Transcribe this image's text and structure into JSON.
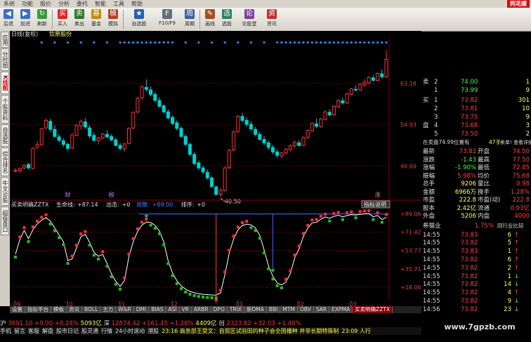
{
  "menubar": {
    "items": [
      "系统",
      "功能",
      "报价",
      "分析",
      "委托",
      "智能",
      "工具",
      "帮助"
    ],
    "brand": "同花顺"
  },
  "toolbar": {
    "buttons": [
      {
        "label": "后退",
        "color": "#3a6fc4",
        "icon": "◀"
      },
      {
        "label": "前进",
        "color": "#3a6fc4",
        "icon": "▶"
      },
      {
        "label": "刷新",
        "color": "#3a9a3a",
        "icon": "↻"
      },
      {
        "label": "买入",
        "color": "#d22",
        "icon": "买"
      },
      {
        "label": "卖出",
        "color": "#2a7a2a",
        "icon": "卖"
      },
      {
        "label": "基金",
        "color": "#c58a00",
        "icon": "基"
      },
      {
        "label": "模拟",
        "color": "#b04020",
        "icon": "模"
      },
      {
        "label": "自选股",
        "color": "#2a5fb0",
        "icon": "★"
      },
      {
        "label": "F10/F9",
        "color": "#607080",
        "icon": "F"
      },
      {
        "label": "周期",
        "color": "#4060a0",
        "icon": "周"
      },
      {
        "label": "画线",
        "color": "#a05020",
        "icon": "✎"
      },
      {
        "label": "选股",
        "color": "#2a8060",
        "icon": "选"
      },
      {
        "label": "论股堂",
        "color": "#8040a0",
        "icon": "论"
      },
      {
        "label": "资讯",
        "color": "#c03030",
        "icon": "资"
      }
    ]
  },
  "left_tabs": [
    {
      "label": "应用",
      "active": false
    },
    {
      "label": "分时图",
      "active": false
    },
    {
      "label": "K线图",
      "active": true
    },
    {
      "label": "个股资料",
      "active": false
    },
    {
      "label": "自选股",
      "active": false
    },
    {
      "label": "综合排名",
      "active": false
    },
    {
      "label": "牛叉诊股",
      "active": false
    },
    {
      "label": "超级盘口",
      "active": false
    }
  ],
  "chart_header": {
    "period": "日线(复权)",
    "stock": "钦原股份"
  },
  "chart_data": {
    "type": "candlestick",
    "price_axis": {
      "ticks": [
        {
          "label": "63.18",
          "value": 63.18
        },
        {
          "label": "54.93",
          "value": 54.93
        },
        {
          "label": "46.69",
          "value": 46.69
        }
      ],
      "range": [
        40,
        72
      ]
    },
    "low_marker": "40.50",
    "candles": [
      [
        45.8,
        46.3,
        45.4,
        45.8
      ],
      [
        45.8,
        46.4,
        45.3,
        46.2
      ],
      [
        46.3,
        47.0,
        46.0,
        46.8
      ],
      [
        47.0,
        47.3,
        46.0,
        46.3
      ],
      [
        46.2,
        50.4,
        46.0,
        50.2
      ],
      [
        50.5,
        51.6,
        50.0,
        51.0
      ],
      [
        51.0,
        54.3,
        50.8,
        54.1
      ],
      [
        54.3,
        56.2,
        54.0,
        55.8
      ],
      [
        55.6,
        56.1,
        53.5,
        54.0
      ],
      [
        54.0,
        54.8,
        52.3,
        52.6
      ],
      [
        52.5,
        53.0,
        51.4,
        51.8
      ],
      [
        51.7,
        52.2,
        50.5,
        51.0
      ],
      [
        51.0,
        51.3,
        49.8,
        50.2
      ],
      [
        50.3,
        53.2,
        50.0,
        52.9
      ],
      [
        52.8,
        55.0,
        52.6,
        54.8
      ],
      [
        54.7,
        56.0,
        54.0,
        55.6
      ],
      [
        55.5,
        56.2,
        54.1,
        54.5
      ],
      [
        54.3,
        54.9,
        52.2,
        52.7
      ],
      [
        52.8,
        53.4,
        51.5,
        51.8
      ],
      [
        51.8,
        52.5,
        51.0,
        52.3
      ],
      [
        52.3,
        53.3,
        52.0,
        53.1
      ],
      [
        53.0,
        53.8,
        52.2,
        52.5
      ],
      [
        52.6,
        53.0,
        51.6,
        51.9
      ],
      [
        51.9,
        52.3,
        50.6,
        50.8
      ],
      [
        50.8,
        51.3,
        49.8,
        50.2
      ],
      [
        50.1,
        51.3,
        49.5,
        51.1
      ],
      [
        51.2,
        54.4,
        51.0,
        54.2
      ],
      [
        54.3,
        57.6,
        54.0,
        57.4
      ],
      [
        57.5,
        60.5,
        57.2,
        60.2
      ],
      [
        60.3,
        62.8,
        60.0,
        62.5
      ],
      [
        62.4,
        64.0,
        61.5,
        62.0
      ],
      [
        61.9,
        62.6,
        60.6,
        61.0
      ],
      [
        61.0,
        61.5,
        59.4,
        59.8
      ],
      [
        59.8,
        60.4,
        58.3,
        58.6
      ],
      [
        58.7,
        59.0,
        57.2,
        57.5
      ],
      [
        57.5,
        58.0,
        56.0,
        56.3
      ],
      [
        56.4,
        56.8,
        54.8,
        55.2
      ],
      [
        55.3,
        55.8,
        53.8,
        54.2
      ],
      [
        54.2,
        54.6,
        52.3,
        52.6
      ],
      [
        52.6,
        53.0,
        50.6,
        51.0
      ],
      [
        51.0,
        51.4,
        48.7,
        49.0
      ],
      [
        49.0,
        49.5,
        46.8,
        47.2
      ],
      [
        47.3,
        47.8,
        45.9,
        46.3
      ],
      [
        46.3,
        46.8,
        45.0,
        45.5
      ],
      [
        45.4,
        46.0,
        44.0,
        44.3
      ],
      [
        44.3,
        44.6,
        42.3,
        42.6
      ],
      [
        42.5,
        42.8,
        40.8,
        41.0
      ],
      [
        41.0,
        42.3,
        40.5,
        41.8
      ],
      [
        41.8,
        46.6,
        41.5,
        46.3
      ],
      [
        46.4,
        50.1,
        46.0,
        49.8
      ],
      [
        49.9,
        53.8,
        49.6,
        53.5
      ],
      [
        53.6,
        56.9,
        53.3,
        56.6
      ],
      [
        56.6,
        57.3,
        55.4,
        55.8
      ],
      [
        55.8,
        56.4,
        54.5,
        55.0
      ],
      [
        55.0,
        55.6,
        53.7,
        54.1
      ],
      [
        54.0,
        54.5,
        52.6,
        53.0
      ],
      [
        53.0,
        53.5,
        51.7,
        52.0
      ],
      [
        52.0,
        52.6,
        50.8,
        51.3
      ],
      [
        51.3,
        51.8,
        49.9,
        50.4
      ],
      [
        50.4,
        50.9,
        49.0,
        49.5
      ],
      [
        49.5,
        50.0,
        48.3,
        48.8
      ],
      [
        48.7,
        49.5,
        48.2,
        49.3
      ],
      [
        49.3,
        50.3,
        49.0,
        50.0
      ],
      [
        50.0,
        51.0,
        49.6,
        50.7
      ],
      [
        50.7,
        51.7,
        50.3,
        51.4
      ],
      [
        51.3,
        51.8,
        50.5,
        50.8
      ],
      [
        50.8,
        52.6,
        50.6,
        52.4
      ],
      [
        52.4,
        54.0,
        52.1,
        53.8
      ],
      [
        53.7,
        55.4,
        53.5,
        55.2
      ],
      [
        55.1,
        56.2,
        54.3,
        54.6
      ],
      [
        54.6,
        56.3,
        54.3,
        56.1
      ],
      [
        56.0,
        57.8,
        55.8,
        57.5
      ],
      [
        57.4,
        58.0,
        56.6,
        56.9
      ],
      [
        56.9,
        58.8,
        56.7,
        58.6
      ],
      [
        58.5,
        60.0,
        58.3,
        59.8
      ],
      [
        59.7,
        60.3,
        59.0,
        59.3
      ],
      [
        59.3,
        61.3,
        59.1,
        61.1
      ],
      [
        61.0,
        62.3,
        60.8,
        62.1
      ],
      [
        62.0,
        62.8,
        61.6,
        61.9
      ],
      [
        61.9,
        63.2,
        61.7,
        63.0
      ],
      [
        62.9,
        64.0,
        62.5,
        63.4
      ],
      [
        63.3,
        64.6,
        63.0,
        64.4
      ],
      [
        64.3,
        64.8,
        63.6,
        63.8
      ],
      [
        63.8,
        65.4,
        63.6,
        65.2
      ],
      [
        65.1,
        66.0,
        64.2,
        64.5
      ],
      [
        64.5,
        69.9,
        64.3,
        68.0
      ]
    ],
    "indicator": {
      "name": "买卖明确ZZTX",
      "params": [
        {
          "label": "生命线:",
          "value": "+87.14"
        },
        {
          "label": "出击:",
          "value": "+0"
        },
        {
          "label": "观察:",
          "value": "+89.00"
        },
        {
          "label": "排序:",
          "value": "+0"
        }
      ],
      "button": "指标说明",
      "axis_ticks": [
        {
          "label": "+89.06",
          "value": 89.06
        },
        {
          "label": "+71.42",
          "value": 71.42
        },
        {
          "label": "+53.77",
          "value": 53.77
        },
        {
          "label": "+35.71",
          "value": 35.71
        },
        {
          "label": "+18.06",
          "value": 18.06
        }
      ],
      "range": [
        5,
        95
      ],
      "signals": [
        "财",
        "税",
        "涨"
      ]
    },
    "x_axis": {
      "ticks": [
        "09",
        "10",
        "11",
        "12",
        "01",
        "02",
        "03"
      ]
    }
  },
  "bottom_tabs": [
    {
      "label": "设置",
      "active": false
    },
    {
      "label": "指标平台",
      "active": false
    },
    {
      "label": "模板",
      "active": false
    },
    {
      "label": "资讯",
      "active": false
    },
    {
      "label": "BOLL",
      "active": false
    },
    {
      "label": "主力",
      "active": false
    },
    {
      "label": "W&R",
      "active": false
    },
    {
      "label": "DMI",
      "active": false
    },
    {
      "label": "BIAS",
      "active": false
    },
    {
      "label": "ASI",
      "active": false
    },
    {
      "label": "VR",
      "active": false
    },
    {
      "label": "ARBR",
      "active": false
    },
    {
      "label": "DPO",
      "active": false
    },
    {
      "label": "TRIX",
      "active": false
    },
    {
      "label": "新DMA",
      "active": false
    },
    {
      "label": "BBI",
      "active": false
    },
    {
      "label": "MTM",
      "active": false
    },
    {
      "label": "OBV",
      "active": false
    },
    {
      "label": "SAR",
      "active": false
    },
    {
      "label": "EXPMA",
      "active": false
    },
    {
      "label": "买卖明确ZZTX",
      "active": true
    }
  ],
  "quote": {
    "orderbook": [
      {
        "side": "卖",
        "lvl": "2",
        "price": "74.00",
        "vol": "1"
      },
      {
        "side": "",
        "lvl": "1",
        "price": "73.99",
        "vol": "9"
      },
      {
        "side": "买",
        "lvl": "1",
        "price": "73.82",
        "vol": "301"
      },
      {
        "side": "",
        "lvl": "2",
        "price": "73.81",
        "vol": "10"
      },
      {
        "side": "",
        "lvl": "3",
        "price": "73.75",
        "vol": "9"
      },
      {
        "side": "盘",
        "lvl": "4",
        "price": "73.68",
        "vol": "3"
      },
      {
        "side": "",
        "lvl": "5",
        "price": "73.50",
        "vol": "2"
      }
    ],
    "notice_left": "在卖盘74.99位置有",
    "notice_mid": "47手",
    "notice_right": "卖单! 查看详细",
    "stats": [
      {
        "l1": "最新",
        "v1": "73.82",
        "l2": "开盘",
        "v2": "74.50"
      },
      {
        "l1": "涨跌",
        "v1": "-1.43",
        "l2": "最高",
        "v2": "77.50"
      },
      {
        "l1": "涨幅",
        "v1": "-1.90%",
        "l2": "最低",
        "v2": "72.85"
      },
      {
        "l1": "振幅",
        "v1": "5.98%",
        "l2": "均价",
        "v2": "75.68"
      },
      {
        "l1": "总手",
        "v1": "9206",
        "l2": "量比",
        "v2": "0.98"
      },
      {
        "l1": "金额",
        "v1": "6966万",
        "l2": "换手",
        "v2": "1.28%"
      },
      {
        "l1": "市盈",
        "v1": "222.8",
        "l2": "市盈(动)",
        "v2": "222.8"
      },
      {
        "l1": "股本",
        "v1": "2.42亿",
        "l2": "流通",
        "v2": "0.93亿"
      },
      {
        "l1": "外盘",
        "v1": "5206",
        "l2": "内盘",
        "v2": "4000"
      }
    ],
    "sector_left": "券猫业",
    "sector_pct": "1.75%",
    "sector_right": "同行业比较",
    "ticks": [
      {
        "t": "14:55",
        "p": "73.83",
        "v": "6",
        "d": "up"
      },
      {
        "t": "14:55",
        "p": "73.82",
        "v": "5",
        "d": "up"
      },
      {
        "t": "14:55",
        "p": "73.83",
        "v": "1",
        "d": "up"
      },
      {
        "t": "14:55",
        "p": "73.82",
        "v": "6",
        "d": "up"
      },
      {
        "t": "14:55",
        "p": "73.82",
        "v": "2",
        "d": "up"
      },
      {
        "t": "14:55",
        "p": "73.82",
        "v": "1",
        "d": "down"
      },
      {
        "t": "14:55",
        "p": "73.82",
        "v": "14",
        "d": "down"
      },
      {
        "t": "14:55",
        "p": "73.82",
        "v": "4",
        "d": "up"
      },
      {
        "t": "14:55",
        "p": "73.82",
        "v": "9",
        "d": "down"
      },
      {
        "t": "14:56",
        "p": "73.82",
        "v": "23",
        "d": "down"
      }
    ]
  },
  "ticker": {
    "sh": "沪",
    "sh_idx": "3691.10",
    "sh_chg": "+9.00",
    "sh_pct": "+0.24%",
    "amt": "5093亿",
    "sz": "深",
    "sz_idx": "12874.42",
    "sz_chg": "+161.45",
    "sz_pct": "+1.26%",
    "sz_amt": "4409亿",
    "cy": "创",
    "cy_idx": "2323.82",
    "cy_chg": "+32.03",
    "cy_pct": "+1.40%"
  },
  "status": {
    "items": [
      "手机",
      "留言",
      "客服",
      "解盘",
      "股市日记",
      "股灵通",
      "行情",
      "24小时滚动",
      "港股"
    ],
    "news": "23:16 商务部王受文：自贸区试验田的种子会全国播种 并非长期特殊制",
    "right": "23:09 人行"
  },
  "watermark": "www.7gpzb.com",
  "colors": {
    "up": "#ff3030",
    "down": "#00d0d0",
    "grid": "#6a0000",
    "text": "#c0c0c0",
    "ma": "#ffffff"
  }
}
